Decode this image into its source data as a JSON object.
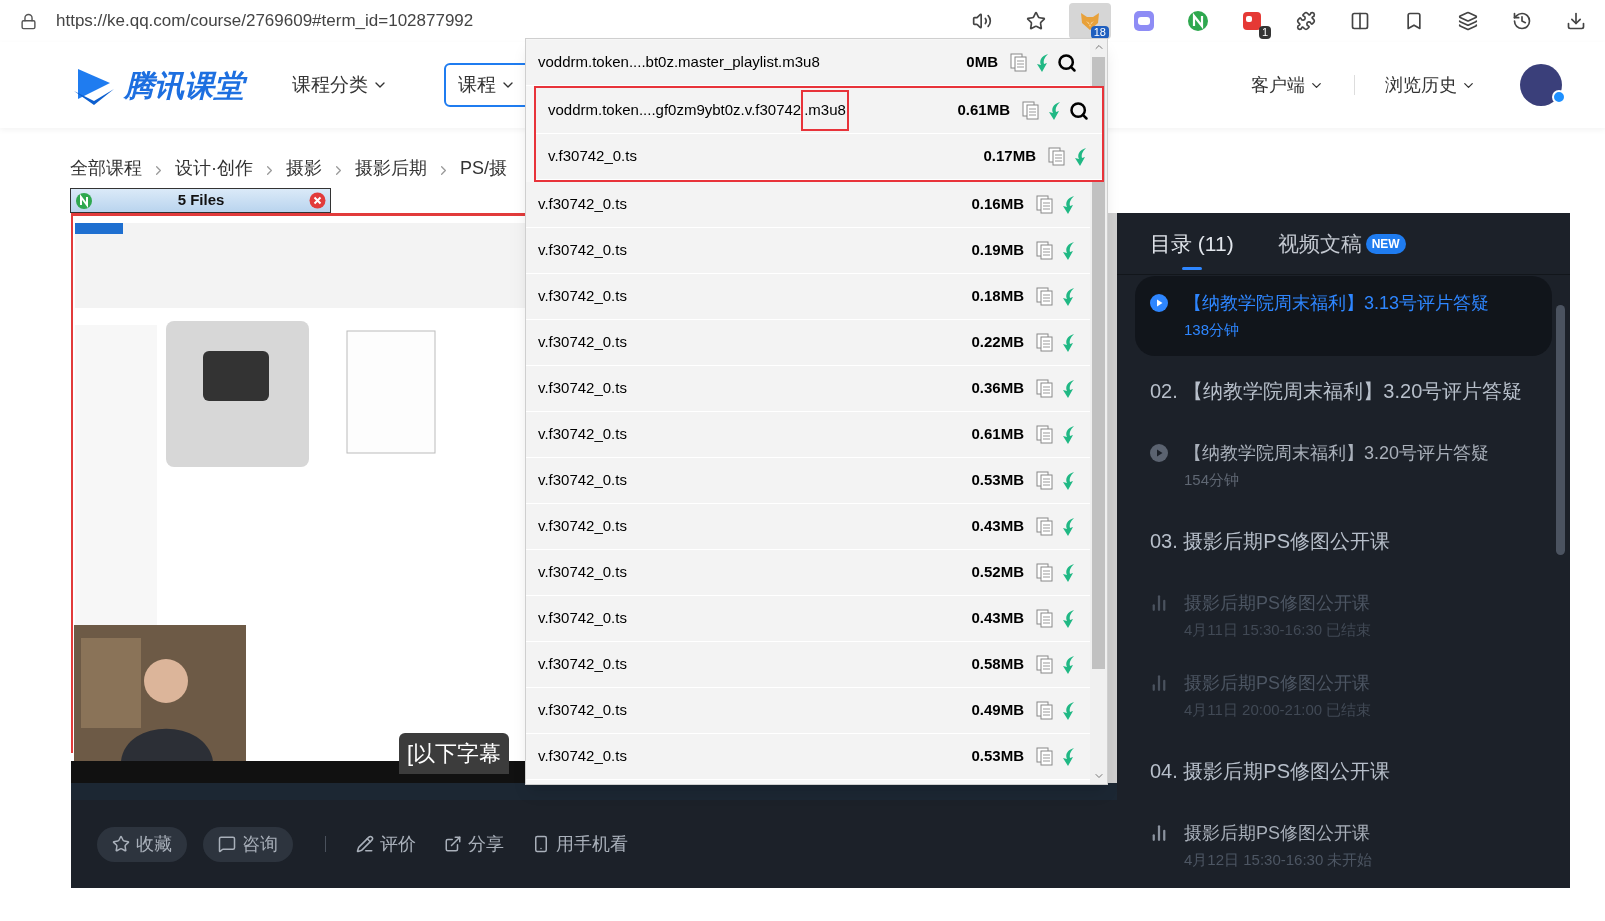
{
  "browser": {
    "url": "https://ke.qq.com/course/2769609#term_id=102877992",
    "toolbar": [
      {
        "kind": "read-aloud",
        "active": false
      },
      {
        "kind": "favorite-add",
        "active": false
      },
      {
        "kind": "fox",
        "badge": "18",
        "active": true
      },
      {
        "kind": "chat",
        "active": false
      },
      {
        "kind": "n-logo",
        "active": false
      },
      {
        "kind": "red-app",
        "badge": "1",
        "active": false
      },
      {
        "kind": "puzzle",
        "active": false
      },
      {
        "kind": "split",
        "active": false
      },
      {
        "kind": "favorites",
        "active": false
      },
      {
        "kind": "collections",
        "active": false
      },
      {
        "kind": "history",
        "active": false
      },
      {
        "kind": "download",
        "active": false
      }
    ]
  },
  "header": {
    "logo_text": "腾讯课堂",
    "nav": "课程分类",
    "search_scope": "课程",
    "links": [
      "客户端",
      "浏览历史"
    ]
  },
  "breadcrumb": [
    "全部课程",
    "设计·创作",
    "摄影",
    "摄影后期",
    "PS/摄"
  ],
  "files_bar": {
    "title": "5 Files"
  },
  "player": {
    "subtitle": "[以下字幕"
  },
  "actions": [
    {
      "label": "收藏",
      "kind": "pill"
    },
    {
      "label": "咨询",
      "kind": "pill"
    },
    {
      "label": "评价",
      "kind": "link"
    },
    {
      "label": "分享",
      "kind": "link"
    },
    {
      "label": "用手机看",
      "kind": "link"
    }
  ],
  "catalog": {
    "tabs": [
      {
        "label": "目录 (11)",
        "selected": true
      },
      {
        "label": "视频文稿",
        "badge": "NEW",
        "selected": false
      }
    ],
    "items": [
      {
        "kind": "lesson",
        "title": "【纳教学院周末福利】3.13号评片答疑",
        "meta": "138分钟",
        "selected": true
      },
      {
        "kind": "chapter",
        "title": "02. 【纳教学院周末福利】3.20号评片答疑"
      },
      {
        "kind": "lesson",
        "title": "【纳教学院周末福利】3.20号评片答疑",
        "meta": "154分钟",
        "selected": false
      },
      {
        "kind": "chapter",
        "title": "03. 摄影后期PS修图公开课"
      },
      {
        "kind": "live",
        "title": "摄影后期PS修图公开课",
        "meta": "4月11日 15:30-16:30 已结束",
        "ended": true
      },
      {
        "kind": "live",
        "title": "摄影后期PS修图公开课",
        "meta": "4月11日 20:00-21:00 已结束",
        "ended": true
      },
      {
        "kind": "chapter",
        "title": "04. 摄影后期PS修图公开课"
      },
      {
        "kind": "live",
        "title": "摄影后期PS修图公开课",
        "meta": "4月12日 15:30-16:30 未开始",
        "ended": false
      }
    ]
  },
  "popup": {
    "rows": [
      {
        "name": "voddrm.token....bt0z.master_playlist.m3u8",
        "size": "0MB",
        "kind": "playlist",
        "annotated": false
      },
      {
        "name": "voddrm.token....gf0zm9ybt0z.v.f30742",
        "boxed_suffix": ".m3u8",
        "size": "0.61MB",
        "kind": "playlist",
        "annotated": true
      },
      {
        "name": "v.f30742_0.ts",
        "size": "0.17MB",
        "kind": "segment",
        "annotated": true
      },
      {
        "name": "v.f30742_0.ts",
        "size": "0.16MB",
        "kind": "segment",
        "annotated": false
      },
      {
        "name": "v.f30742_0.ts",
        "size": "0.19MB",
        "kind": "segment",
        "annotated": false
      },
      {
        "name": "v.f30742_0.ts",
        "size": "0.18MB",
        "kind": "segment",
        "annotated": false
      },
      {
        "name": "v.f30742_0.ts",
        "size": "0.22MB",
        "kind": "segment",
        "annotated": false
      },
      {
        "name": "v.f30742_0.ts",
        "size": "0.36MB",
        "kind": "segment",
        "annotated": false
      },
      {
        "name": "v.f30742_0.ts",
        "size": "0.61MB",
        "kind": "segment",
        "annotated": false
      },
      {
        "name": "v.f30742_0.ts",
        "size": "0.53MB",
        "kind": "segment",
        "annotated": false
      },
      {
        "name": "v.f30742_0.ts",
        "size": "0.43MB",
        "kind": "segment",
        "annotated": false
      },
      {
        "name": "v.f30742_0.ts",
        "size": "0.52MB",
        "kind": "segment",
        "annotated": false
      },
      {
        "name": "v.f30742_0.ts",
        "size": "0.43MB",
        "kind": "segment",
        "annotated": false
      },
      {
        "name": "v.f30742_0.ts",
        "size": "0.58MB",
        "kind": "segment",
        "annotated": false
      },
      {
        "name": "v.f30742_0.ts",
        "size": "0.49MB",
        "kind": "segment",
        "annotated": false
      },
      {
        "name": "v.f30742_0.ts",
        "size": "0.53MB",
        "kind": "segment",
        "annotated": false
      }
    ]
  }
}
